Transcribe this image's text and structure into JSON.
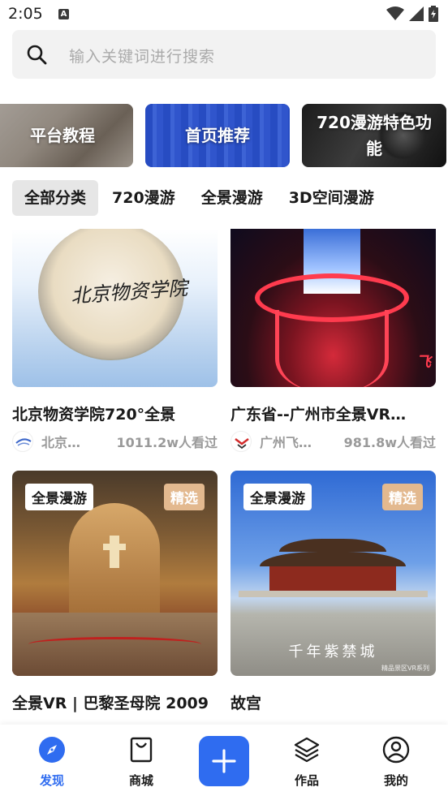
{
  "status_bar": {
    "time": "2:05",
    "notification_icon": "A"
  },
  "search": {
    "placeholder": "输入关键词进行搜索"
  },
  "banners": [
    {
      "label": "平台教程"
    },
    {
      "label": "首页推荐"
    },
    {
      "label_line1": "720漫游特色功",
      "label_line2": "能"
    }
  ],
  "tabs": [
    {
      "label": "全部分类",
      "active": true
    },
    {
      "label": "720漫游"
    },
    {
      "label": "全景漫游"
    },
    {
      "label": "3D空间漫游"
    }
  ],
  "cards": [
    {
      "title": "北京物资学院720°全景",
      "author": "北京…",
      "views": "1011.2w人看过",
      "image_text": "北京物资学院"
    },
    {
      "title": "广东省--广州市全景VR…",
      "author": "广州飞…",
      "views": "981.8w人看过",
      "image_text": "飞"
    },
    {
      "title": "全景VR | 巴黎圣母院 2009",
      "tag": "全景漫游",
      "badge": "精选"
    },
    {
      "title": "故宫",
      "tag": "全景漫游",
      "badge": "精选",
      "image_caption": "千年紫禁城",
      "image_caption_small": "精品景区VR系列"
    }
  ],
  "bottom_nav": [
    {
      "label": "发现",
      "icon": "compass-icon",
      "active": true
    },
    {
      "label": "商城",
      "icon": "shopping-bag-icon"
    },
    {
      "label": "",
      "icon": "plus-icon"
    },
    {
      "label": "作品",
      "icon": "layers-icon"
    },
    {
      "label": "我的",
      "icon": "user-icon"
    }
  ],
  "colors": {
    "accent": "#2f6cf0",
    "badge": "#e3b98f",
    "text": "#1a1a1a",
    "muted": "#9a9a9a"
  }
}
